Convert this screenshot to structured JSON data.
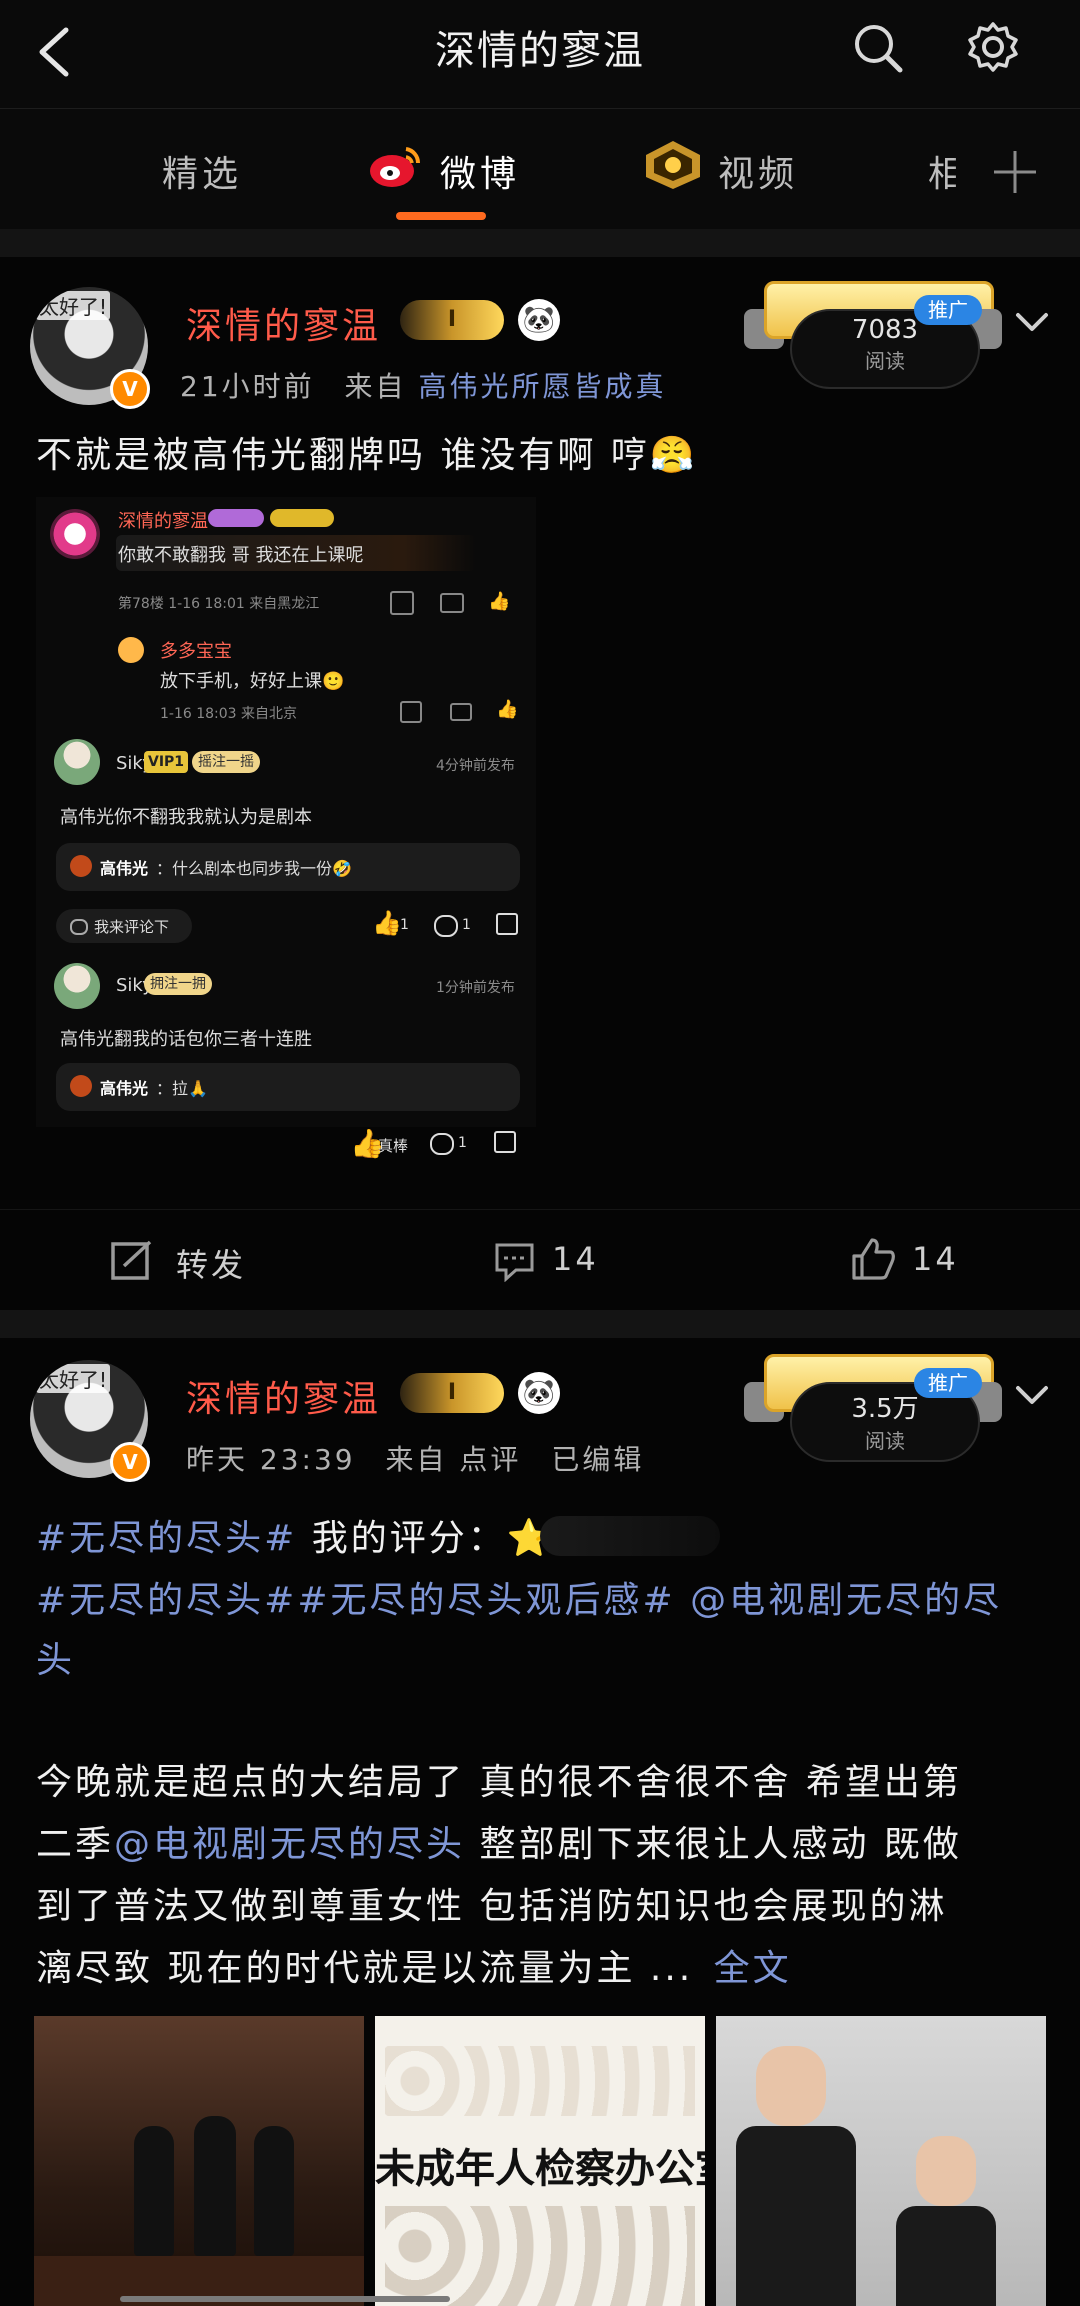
{
  "header": {
    "title": "深情的寥温"
  },
  "tabs": [
    {
      "label": "精选"
    },
    {
      "label": "微博"
    },
    {
      "label": "视频"
    },
    {
      "label": "相"
    }
  ],
  "posts": [
    {
      "username": "深情的寥温",
      "level_badge": "I",
      "time": "21小时前",
      "source_prefix": "来自",
      "source": "高伟光所愿皆成真",
      "reads": "7083",
      "reads_label": "阅读",
      "promo_label": "推广",
      "text": "不就是被高伟光翻牌吗 谁没有啊 哼😤",
      "embed": {
        "comment1_name": "深情的寥温",
        "comment1_text": "你敢不敢翻我 哥 我还在上课呢",
        "comment1_meta": "第78楼 1-16 18:01 来自黑龙江",
        "reply1_name": "多多宝宝",
        "reply1_text": "放下手机，好好上课🙂",
        "reply1_meta": "1-16 18:03 来自北京",
        "comment2_name": "Siky",
        "comment2_badge": "VIP1",
        "comment2_tag": "摇注一摇",
        "comment2_time": "4分钟前发布",
        "comment2_text": "高伟光你不翻我我就认为是剧本",
        "comment2_reply_name": "高伟光",
        "comment2_reply_text": "：什么剧本也同步我一份🤣",
        "reply_link": "我来评论下",
        "comment2_likes": "1",
        "comment2_comments": "1",
        "comment3_name": "Siky",
        "comment3_tag": "拥注一拥",
        "comment3_time": "1分钟前发布",
        "comment3_text": "高伟光翻我的话包你三者十连胜",
        "comment3_reply_name": "高伟光",
        "comment3_reply_text": "：拉🙏",
        "comment3_likes": "真棒",
        "comment3_comments": "1"
      },
      "repost_label": "转发",
      "comments": "14",
      "likes": "14"
    },
    {
      "username": "深情的寥温",
      "level_badge": "I",
      "time": "昨天 23:39",
      "source_prefix": "来自",
      "source": "点评",
      "edited": "已编辑",
      "reads": "3.5万",
      "reads_label": "阅读",
      "promo_label": "推广",
      "line1_tag": "#无尽的尽头#",
      "line1_text": " 我的评分：⭐",
      "line2_tags": "#无尽的尽头##无尽的尽头观后感# @电视剧无尽的尽",
      "line3_tail": "头",
      "body_line1": "今晚就是超点的大结局了 真的很不舍很不舍 希望出第",
      "body_line2_pre": "二季",
      "body_line2_link": "@电视剧无尽的尽头",
      "body_line2_post": " 整部剧下来很让人感动 既做",
      "body_line3": "到了普法又做到尊重女性 包括消防知识也会展现的淋",
      "body_line4": "漓尽致 现在的时代就是以流量为主 ...",
      "full_text_link": "全文",
      "photo2_caption": "未成年人检察办公室"
    }
  ],
  "colors": {
    "accent": "#ff6a1f",
    "username": "#ff5b4a",
    "link": "#7f96d6",
    "promo": "#2b85e4"
  }
}
